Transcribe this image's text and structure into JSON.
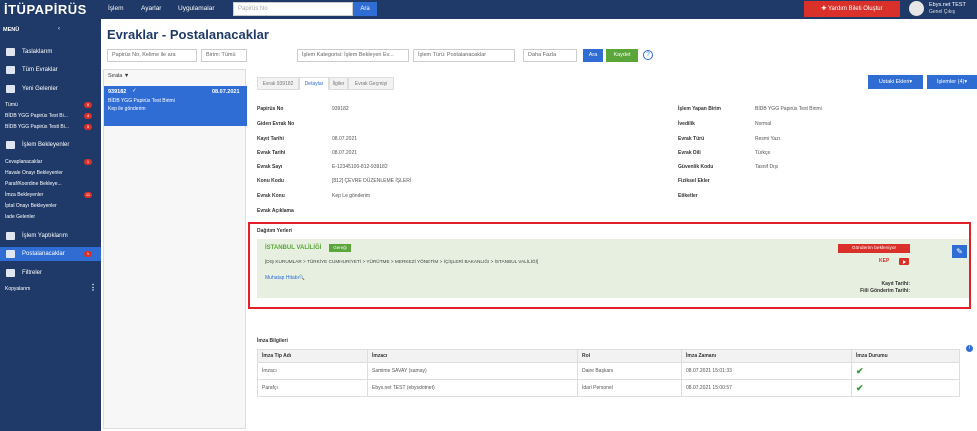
{
  "app": {
    "logo": "İTÜPAPİRÜS"
  },
  "topnav": {
    "items": [
      "İşlem",
      "Ayarlar",
      "Uygulamalar"
    ],
    "search_placeholder": "Papirüs No",
    "search_button": "Ara",
    "help_button": "Yardım Bileti Oluştur",
    "user_name": "Ebys.net TEST",
    "user_role": "Genel Çıkış"
  },
  "sidebar": {
    "menu_title": "MENÜ",
    "items": {
      "taslaklarim": "Taslaklarım",
      "tum_evraklar": "Tüm Evraklar",
      "yeni_gelenler": "Yeni Gelenler",
      "islem_bekleyenler": "İşlem Bekleyenler",
      "islem_yaptiklarim": "İşlem Yaptıklarım",
      "postalanacaklar": "Postalanacaklar",
      "filtreler": "Filtreler"
    },
    "yeni_sub": [
      {
        "label": "Tümü",
        "badge": "6"
      },
      {
        "label": "BİDB YGG Papirüs Test Bi...",
        "badge": "4"
      },
      {
        "label": "BİDB YGG Papirüs Testi Bi...",
        "badge": "5"
      }
    ],
    "islem_sub": [
      {
        "label": "Cevaplanacaklar",
        "badge": "1"
      },
      {
        "label": "Havale Onayı Bekleyenler",
        "badge": ""
      },
      {
        "label": "Paraf/Koordine Bekleye...",
        "badge": ""
      },
      {
        "label": "İmza Bekleyenler",
        "badge": "11"
      },
      {
        "label": "İptal Onayı Bekleyenler",
        "badge": ""
      },
      {
        "label": "Iade Gelenler",
        "badge": ""
      }
    ],
    "postalanacaklar_badge": "1",
    "kopyalanlar": "Kopyalarım"
  },
  "page": {
    "title": "Evraklar - Postalanacaklar"
  },
  "filters": {
    "search_placeholder": "Papirüs No, Kelime ile ara",
    "birim": "Birim: Tümü",
    "kategori": "İşlem Kategorisi: İşlem Bekleyen Ev...",
    "tur": "İşlem Türü: Postalanacaklar",
    "daha": "Daha Fazla",
    "ara": "Ara",
    "kaydet": "Kaydet"
  },
  "list": {
    "sort_label": "Sırala",
    "doc": {
      "no": "939182",
      "date": "08.07.2021",
      "line1": "BİDB YGG Papirüs Test Birimi",
      "line2": "Kep ile gönderim"
    }
  },
  "tabs": [
    "Evrak 939182",
    "Detaylar",
    "İlgiler",
    "Evrak Geçmişi"
  ],
  "actions": {
    "ustyazi": "Ustaki Ekleri▾",
    "islemler": "İşlemler (4)▾"
  },
  "details_left": [
    {
      "label": "Papirüs No",
      "value": "939182"
    },
    {
      "label": "Giden Evrak No",
      "value": ""
    },
    {
      "label": "Kayıt Tarihi",
      "value": "08.07.2021"
    },
    {
      "label": "Evrak Tarihi",
      "value": "08.07.2021"
    },
    {
      "label": "Evrak Sayı",
      "value": "E-12345100-812-939182"
    },
    {
      "label": "Konu Kodu",
      "value": "[812] ÇEVRE DÜZENLEME İŞLERİ"
    },
    {
      "label": "Evrak Konu",
      "value": "Kep Le gönderim"
    },
    {
      "label": "Evrak Açıklama",
      "value": ""
    }
  ],
  "details_right": [
    {
      "label": "İşlem Yapan Birim",
      "value": "BİDB YGG Papirüs Test Birimi"
    },
    {
      "label": "İvedilik",
      "value": "Normal"
    },
    {
      "label": "Evrak Türü",
      "value": "Resmi Yazı"
    },
    {
      "label": "Evrak Dili",
      "value": "Türkçe"
    },
    {
      "label": "Güvenlik Kodu",
      "value": "Tasnif Dışı"
    },
    {
      "label": "Fiziksel Ekler",
      "value": ""
    },
    {
      "label": "Etiketler",
      "value": ""
    }
  ],
  "dagitim": {
    "title": "Dağıtım Yerleri",
    "recipient": "İSTANBUL VALİLİĞİ",
    "badge": "Gereği",
    "path": "[DIŞ KURUMLAR > TÜRKİYE CUMHURİYETİ > YÜRÜTME > MERKEZİ YÖNETİM > İÇİŞLERİ BAKANLIĞI > İSTANBUL VALİLİĞİ]",
    "muhatap": "Muhatap Hitabı🔍",
    "status": "Gönderim bekleniyor",
    "kep": "KEP",
    "kayit_tarihi": "Kayıt Tarihi:",
    "fiili": "Fiili Gönderim Tarihi:"
  },
  "imza": {
    "title": "İmza Bilgileri",
    "headers": [
      "İmza Tip Adı",
      "İmzacı",
      "Rol",
      "İmza Zamanı",
      "İmza Durumu"
    ],
    "rows": [
      [
        "İmzacı",
        "Samime SAVAY (samay)",
        "Daire Başkanı",
        "08.07.2021 15:01:33"
      ],
      [
        "Parafçı",
        "Ebys.net TEST (ebysdotnet)",
        "İdari Personel",
        "08.07.2021 15:00:57"
      ]
    ]
  }
}
